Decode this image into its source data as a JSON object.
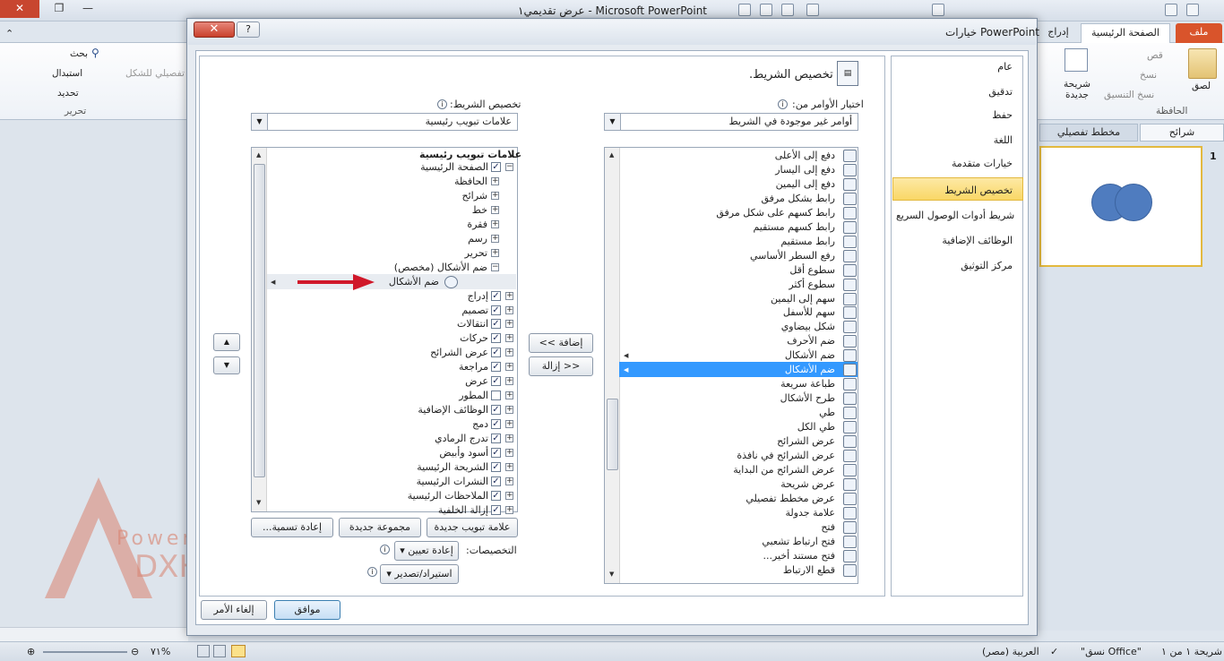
{
  "window": {
    "title": "Microsoft PowerPoint  -  عرض تقديمي١",
    "ribbon_tabs": {
      "file": "ملف",
      "home": "الصفحة الرئيسية",
      "insert": "إدراج"
    },
    "ribbon": {
      "paste": "لصق",
      "cut": "قص",
      "copy": "نسخ",
      "format_painter": "نسخ التنسيق",
      "new_slide": "شريحة جديدة",
      "clipboard_group": "الحافظة",
      "find": "بحث",
      "replace": "استبدال",
      "select": "تحديد",
      "editing_group": "تحرير",
      "shape_label": "تفصيلي للشكل"
    },
    "side_pane": {
      "slides_tab": "شرائح",
      "outline_tab": "مخطط تفصيلي",
      "slide_number": "1"
    },
    "status": {
      "slide": "شريحة ١ من ١",
      "theme": "\"نسق Office\"",
      "language": "العربية (مصر)",
      "zoom": "٧١%"
    },
    "watermark": {
      "letter": "A",
      "brand": "Powerpoint",
      "name": "DXHA"
    }
  },
  "dialog": {
    "title": "خيارات PowerPoint",
    "close_label": "✕",
    "help_label": "?",
    "categories": [
      "عام",
      "تدقيق",
      "حفظ",
      "اللغة",
      "خيارات متقدمة",
      "تخصيص الشريط",
      "شريط أدوات الوصول السريع",
      "الوظائف الإضافية",
      "مركز التوثيق"
    ],
    "selected_category": "تخصيص الشريط",
    "header": "تخصيص الشريط.",
    "choose_commands_label": "اختيار الأوامر من:",
    "choose_commands_value": "أوامر غير موجودة في الشريط",
    "customize_ribbon_label": "تخصيص الشريط:",
    "customize_ribbon_value": "علامات تبويب رئيسية",
    "commands": [
      "دفع إلى الأعلى",
      "دفع إلى اليسار",
      "دفع إلى اليمين",
      "رابط بشكل مرفق",
      "رابط كسهم على شكل مرفق",
      "رابط كسهم مستقيم",
      "رابط مستقيم",
      "رفع السطر الأساسي",
      "سطوع أقل",
      "سطوع أكثر",
      "سهم إلى اليمين",
      "سهم للأسفل",
      "شكل بيضاوي",
      "ضم الأحرف",
      "ضم الأشكال",
      "ضم الأشكال",
      "طباعة سريعة",
      "طرح الأشكال",
      "طي",
      "طي الكل",
      "عرض الشرائح",
      "عرض الشرائح في نافذة",
      "عرض الشرائح من البداية",
      "عرض شريحة",
      "عرض مخطط تفصيلي",
      "علامة جدولة",
      "فتح",
      "فتح ارتباط تشعبي",
      "فتح مستند أخير...",
      "قطع الارتباط"
    ],
    "selected_command_index": 15,
    "tree_header": "علامات تبويب رئيسية",
    "tree": [
      {
        "level": 0,
        "exp": "⊟",
        "chk": true,
        "text": "الصفحة الرئيسية"
      },
      {
        "level": 1,
        "exp": "⊞",
        "chk": null,
        "text": "الحافظة"
      },
      {
        "level": 1,
        "exp": "⊞",
        "chk": null,
        "text": "شرائح"
      },
      {
        "level": 1,
        "exp": "⊞",
        "chk": null,
        "text": "خط"
      },
      {
        "level": 1,
        "exp": "⊞",
        "chk": null,
        "text": "فقرة"
      },
      {
        "level": 1,
        "exp": "⊞",
        "chk": null,
        "text": "رسم"
      },
      {
        "level": 1,
        "exp": "⊞",
        "chk": null,
        "text": "تحرير"
      },
      {
        "level": 1,
        "exp": "⊟",
        "chk": null,
        "text": "ضم الأشكال (مخصص)"
      },
      {
        "level": 2,
        "exp": "",
        "chk": null,
        "text": "ضم الأشكال"
      },
      {
        "level": 0,
        "exp": "⊞",
        "chk": true,
        "text": "إدراج"
      },
      {
        "level": 0,
        "exp": "⊞",
        "chk": true,
        "text": "تصميم"
      },
      {
        "level": 0,
        "exp": "⊞",
        "chk": true,
        "text": "انتقالات"
      },
      {
        "level": 0,
        "exp": "⊞",
        "chk": true,
        "text": "حركات"
      },
      {
        "level": 0,
        "exp": "⊞",
        "chk": true,
        "text": "عرض الشرائح"
      },
      {
        "level": 0,
        "exp": "⊞",
        "chk": true,
        "text": "مراجعة"
      },
      {
        "level": 0,
        "exp": "⊞",
        "chk": true,
        "text": "عرض"
      },
      {
        "level": 0,
        "exp": "⊞",
        "chk": false,
        "text": "المطور"
      },
      {
        "level": 0,
        "exp": "⊞",
        "chk": true,
        "text": "الوظائف الإضافية"
      },
      {
        "level": 0,
        "exp": "⊞",
        "chk": true,
        "text": "دمج"
      },
      {
        "level": 0,
        "exp": "⊞",
        "chk": true,
        "text": "تدرج الرمادي"
      },
      {
        "level": 0,
        "exp": "⊞",
        "chk": true,
        "text": "أسود وأبيض"
      },
      {
        "level": 0,
        "exp": "⊞",
        "chk": true,
        "text": "الشريحة الرئيسية"
      },
      {
        "level": 0,
        "exp": "⊞",
        "chk": true,
        "text": "النشرات الرئيسية"
      },
      {
        "level": 0,
        "exp": "⊞",
        "chk": true,
        "text": "الملاحظات الرئيسية"
      },
      {
        "level": 0,
        "exp": "⊞",
        "chk": true,
        "text": "إزالة الخلفية"
      }
    ],
    "add_button": "إضافة >>",
    "remove_button": "<< إزالة",
    "new_tab_button": "علامة تبويب جديدة",
    "new_group_button": "مجموعة جديدة",
    "rename_button": "إعادة تسمية...",
    "customizations_label": "التخصيصات:",
    "reset_button": "إعادة تعيين",
    "import_export_button": "استيراد/تصدير",
    "ok_button": "موافق",
    "cancel_button": "إلغاء الأمر"
  }
}
